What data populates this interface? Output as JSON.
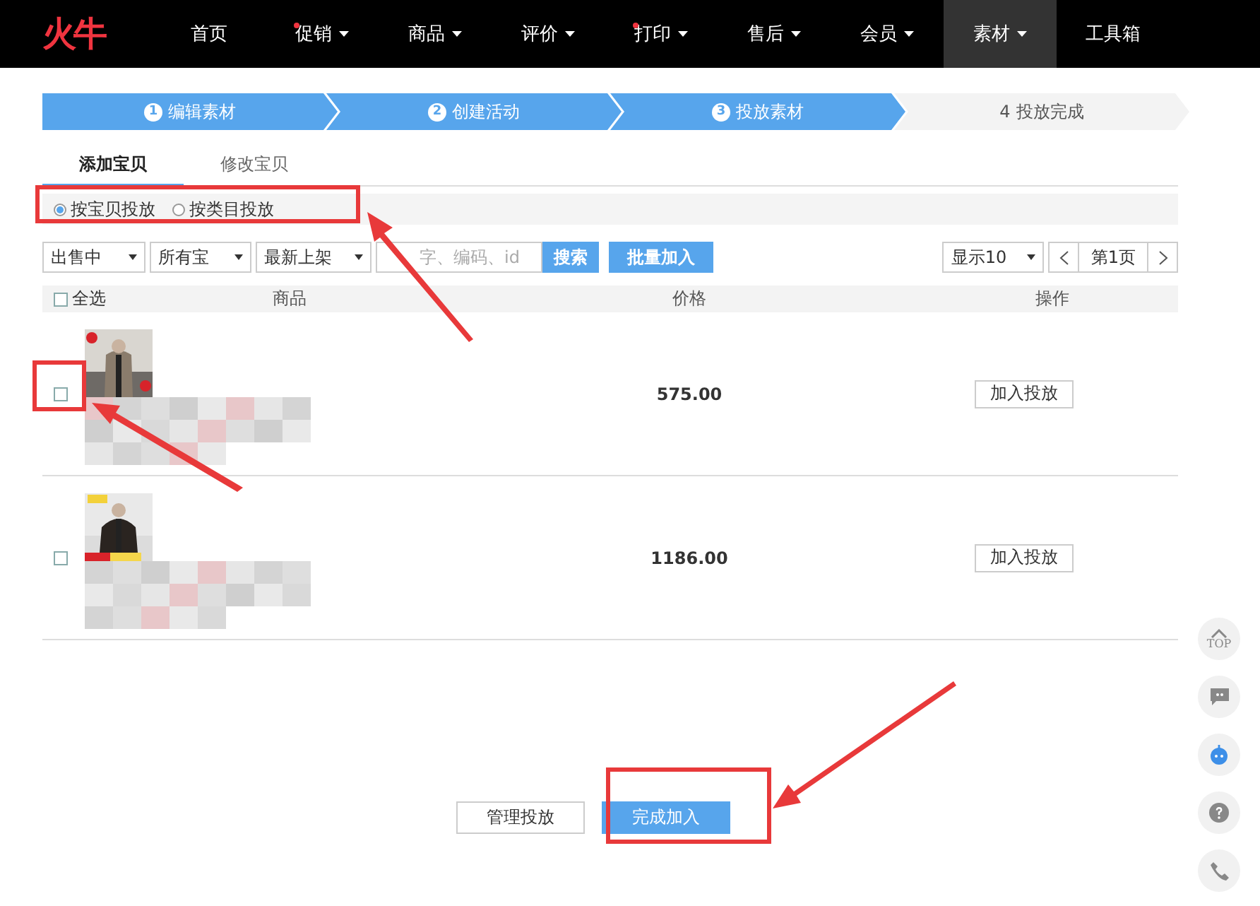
{
  "nav": {
    "logo": "火牛",
    "items": [
      {
        "label": "首页",
        "dot": false,
        "caret": false,
        "selected": false
      },
      {
        "label": "促销",
        "dot": true,
        "caret": true,
        "selected": false
      },
      {
        "label": "商品",
        "dot": false,
        "caret": true,
        "selected": false
      },
      {
        "label": "评价",
        "dot": false,
        "caret": true,
        "selected": false
      },
      {
        "label": "打印",
        "dot": true,
        "caret": true,
        "selected": false
      },
      {
        "label": "售后",
        "dot": false,
        "caret": true,
        "selected": false
      },
      {
        "label": "会员",
        "dot": false,
        "caret": true,
        "selected": false
      },
      {
        "label": "素材",
        "dot": false,
        "caret": true,
        "selected": true
      },
      {
        "label": "工具箱",
        "dot": false,
        "caret": false,
        "selected": false
      }
    ]
  },
  "steps": [
    {
      "number": "1",
      "label": "编辑素材",
      "done": true
    },
    {
      "number": "2",
      "label": "创建活动",
      "done": true
    },
    {
      "number": "3",
      "label": "投放素材",
      "done": true
    },
    {
      "number": "4",
      "label": "投放完成",
      "done": false
    }
  ],
  "tabs": [
    {
      "label": "添加宝贝",
      "selected": true
    },
    {
      "label": "修改宝贝",
      "selected": false
    }
  ],
  "modes": [
    {
      "label": "按宝贝投放",
      "selected": true
    },
    {
      "label": "按类目投放",
      "selected": false
    }
  ],
  "filters": [
    "出售中",
    "所有宝",
    "最新上架"
  ],
  "search": {
    "placeholder": "字、编码、id",
    "button": "搜索"
  },
  "batch_button": "批量加入",
  "page_size": "显示10",
  "page": "第1页",
  "table": {
    "select_all": {
      "label": "全选",
      "checked": false
    },
    "columns": [
      "商品",
      "价格",
      "操作"
    ],
    "rows": [
      {
        "checked": false,
        "price": "575.00",
        "action": "加入投放"
      },
      {
        "checked": false,
        "price": "1186.00",
        "action": "加入投放"
      }
    ]
  },
  "footer": {
    "secondary": "管理投放",
    "primary": "完成加入"
  },
  "side_tools": {
    "top_label": "TOP"
  }
}
